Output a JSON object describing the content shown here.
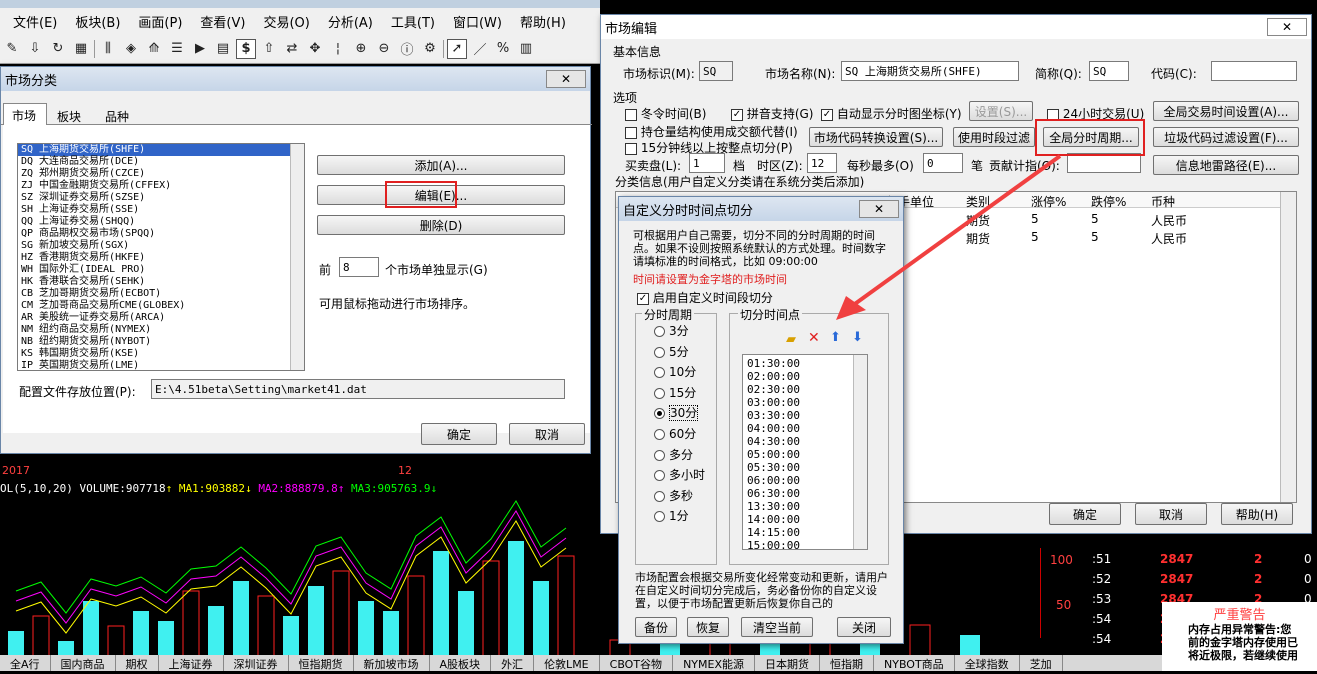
{
  "menu": [
    "文件(E)",
    "板块(B)",
    "画面(P)",
    "查看(V)",
    "交易(O)",
    "分析(A)",
    "工具(T)",
    "窗口(W)",
    "帮助(H)"
  ],
  "market_dlg": {
    "title": "市场分类",
    "tabs": [
      "市场",
      "板块",
      "品种"
    ],
    "list": [
      "SQ 上海期货交易所(SHFE)",
      "DQ 大连商品交易所(DCE)",
      "ZQ 郑州期货交易所(CZCE)",
      "ZJ 中国金融期货交易所(CFFEX)",
      "SZ 深圳证券交易所(SZSE)",
      "SH 上海证券交易所(SSE)",
      "QQ 上海证券交易(SHQQ)",
      "QP 商品期权交易市场(SPQQ)",
      "SG 新加坡交易所(SGX)",
      "HZ 香港期货交易所(HKFE)",
      "WH 国际外汇(IDEAL PRO)",
      "HK 香港联合交易所(SEHK)",
      "CB 芝加哥期货交易所(ECBOT)",
      "CM 芝加哥商品交易所CME(GLOBEX)",
      "AR 美股统一证券交易所(ARCA)",
      "NM 纽约商品交易所(NYMEX)",
      "NB 纽约期货交易所(NYBOT)",
      "KS 韩国期货交易所(KSE)",
      "IP 英国期货交易所(LME)"
    ],
    "add": "添加(A)...",
    "edit": "编辑(E)...",
    "del": "删除(D)",
    "front_label": "前",
    "front_val": "8",
    "front_suffix": "个市场单独显示(G)",
    "drag_tip": "可用鼠标拖动进行市场排序。",
    "path_label": "配置文件存放位置(P):",
    "path_val": "E:\\4.51beta\\Setting\\market41.dat",
    "ok": "确定",
    "cancel": "取消"
  },
  "edit_dlg": {
    "title": "市场编辑",
    "basic": "基本信息",
    "id_label": "市场标识(M):",
    "id_val": "SQ",
    "name_label": "市场名称(N):",
    "name_val": "SQ 上海期货交易所(SHFE)",
    "abbr_label": "简称(Q):",
    "abbr_val": "SQ",
    "code_label": "代码(C):",
    "code_val": "",
    "options": "选项",
    "cb_time": "冬令时间(B)",
    "cb_pinyin": "拼音支持(G)",
    "cb_auto": "自动显示分时图坐标(Y)",
    "setting_btn": "设置(S)...",
    "cb_24h": "24小时交易(U)",
    "global_trade_btn": "全局交易时间设置(A)...",
    "cb_hold": "持仓量结构使用成交额代替(I)",
    "cb_15": "15分钟线以上按整点切分(P)",
    "conv_btn": "市场代码转换设置(S)...",
    "period_btn": "使用时段过滤",
    "global_split_btn": "全局分时周期...",
    "junk_btn": "垃圾代码过滤设置(F)...",
    "buy_label": "买卖盘(L):",
    "buy_val": "1",
    "dang": "档",
    "tz_label": "时区(Z):",
    "tz_val": "12",
    "per_sec": "每秒最多(O)",
    "per_val": "0",
    "bi": "笔",
    "contrib": "贡献计指(O):",
    "contrib_val": "",
    "geo_btn": "信息地雷路径(E)...",
    "cat_label": "分类信息(用户自定义分类请在系统分类后添加)",
    "cols": [
      "每手单位",
      "类别",
      "涨停%",
      "跌停%",
      "币种"
    ],
    "rows": [
      [
        "",
        "期货",
        "5",
        "5",
        "人民币"
      ],
      [
        "",
        "期货",
        "5",
        "5",
        "人民币"
      ]
    ],
    "ok": "确定",
    "cancel": "取消",
    "help": "帮助(H)"
  },
  "split_dlg": {
    "title": "自定义分时时间点切分",
    "desc": "可根据用户自己需要，切分不同的分时周期的时间点。如果不设则按照系统默认的方式处理。时间数字请填标准的时间格式，比如 09:00:00",
    "warn": "时间请设置为金字塔的市场时间",
    "enable": "启用自定义时间段切分",
    "period_group": "分时周期",
    "periods": [
      "3分",
      "5分",
      "10分",
      "15分",
      "30分",
      "60分",
      "多分",
      "多小时",
      "多秒",
      "1分"
    ],
    "points_group": "切分时间点",
    "times": [
      "01:30:00",
      "02:00:00",
      "02:30:00",
      "03:00:00",
      "03:30:00",
      "04:00:00",
      "04:30:00",
      "05:00:00",
      "05:30:00",
      "06:00:00",
      "06:30:00",
      "13:30:00",
      "14:00:00",
      "14:15:00",
      "15:00:00"
    ],
    "note": "市场配置会根据交易所变化经常变动和更新，请用户在自定义时间切分完成后，务必备份你的自定义设置，以便于市场配置更新后恢复你自己的",
    "backup": "备份",
    "restore": "恢复",
    "clear": "清空当前",
    "close": "关闭"
  },
  "chart": {
    "year": "2017",
    "month": "12",
    "indicator": "OL(5,10,20) VOLUME:907718",
    "ma1": "MA1:903882",
    "ma2": "MA2:888879.8",
    "ma3": "MA3:905763.9",
    "ylabels": [
      "100",
      "50"
    ],
    "quotes": [
      [
        ":51",
        "2847",
        "2",
        "0"
      ],
      [
        ":52",
        "2847",
        "2",
        "0"
      ],
      [
        ":53",
        "2847",
        "2",
        "0"
      ],
      [
        ":54",
        "2847",
        "2",
        "0"
      ],
      [
        ":54",
        "2847",
        "1",
        "0"
      ]
    ],
    "warn_title": "严重警告",
    "warn_lines": [
      "内存占用异常警告:您",
      "前的金字塔内存使用已",
      "将近极限，若继续使用"
    ],
    "bottom_tabs": [
      "全A行",
      "国内商品",
      "期权",
      "上海证券",
      "深圳证券",
      "恒指期货",
      "新加坡市场",
      "A股板块",
      "外汇",
      "伦敦LME",
      "CBOT谷物",
      "NYMEX能源",
      "日本期货",
      "恒指期",
      "NYBOT商品",
      "全球指数",
      "芝加"
    ]
  }
}
